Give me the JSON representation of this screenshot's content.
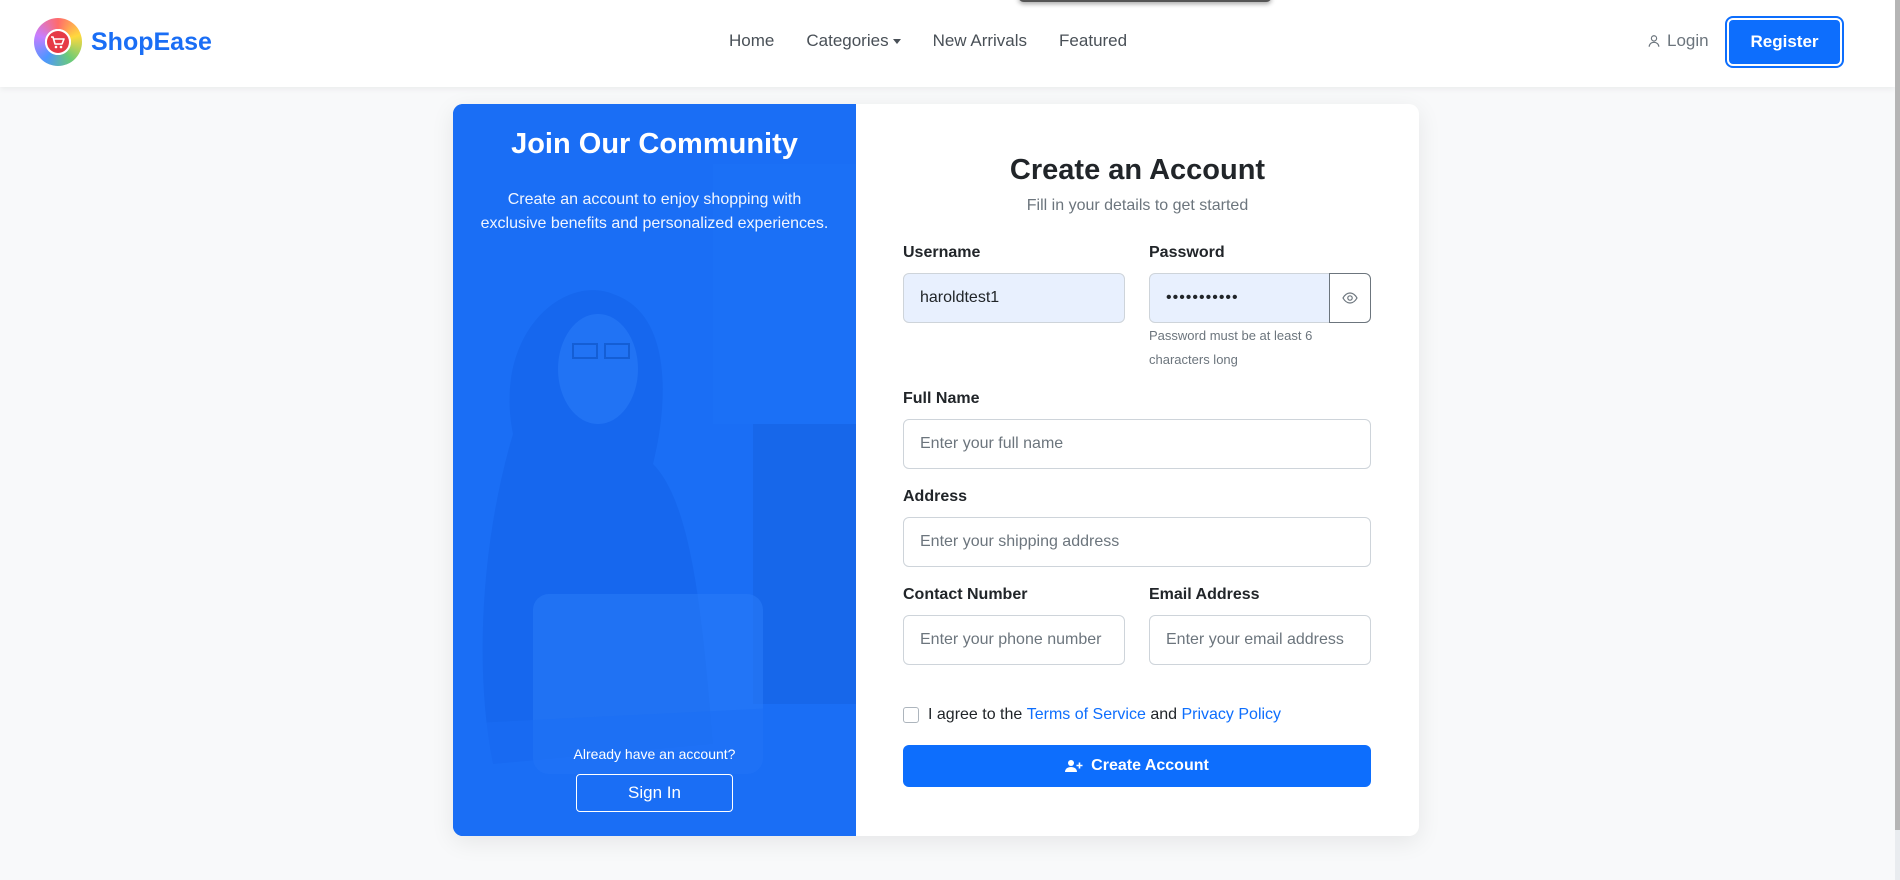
{
  "brand": {
    "name": "ShopEase",
    "logo_icon": "shopping-cart-icon"
  },
  "nav": {
    "links": [
      {
        "label": "Home"
      },
      {
        "label": "Categories",
        "has_dropdown": true
      },
      {
        "label": "New Arrivals"
      },
      {
        "label": "Featured"
      }
    ],
    "login_label": "Login",
    "register_label": "Register"
  },
  "left_panel": {
    "title": "Join Our Community",
    "description": "Create an account to enjoy shopping with exclusive benefits and personalized experiences.",
    "already_text": "Already have an account?",
    "signin_label": "Sign In"
  },
  "form": {
    "title": "Create an Account",
    "subtitle": "Fill in your details to get started",
    "username": {
      "label": "Username",
      "value": "haroldtest1"
    },
    "password": {
      "label": "Password",
      "value": "•••••••••••",
      "hint": "Password must be at least 6 characters long"
    },
    "full_name": {
      "label": "Full Name",
      "placeholder": "Enter your full name"
    },
    "address": {
      "label": "Address",
      "placeholder": "Enter your shipping address"
    },
    "contact": {
      "label": "Contact Number",
      "placeholder": "Enter your phone number"
    },
    "email": {
      "label": "Email Address",
      "placeholder": "Enter your email address"
    },
    "agree": {
      "prefix": "I agree to the ",
      "terms": "Terms of Service",
      "middle": " and ",
      "privacy": "Privacy Policy"
    },
    "submit_label": "Create Account"
  },
  "colors": {
    "primary": "#0d6efd",
    "panel_blue": "#1a6ef5",
    "input_autofill": "#e8f0fe"
  }
}
